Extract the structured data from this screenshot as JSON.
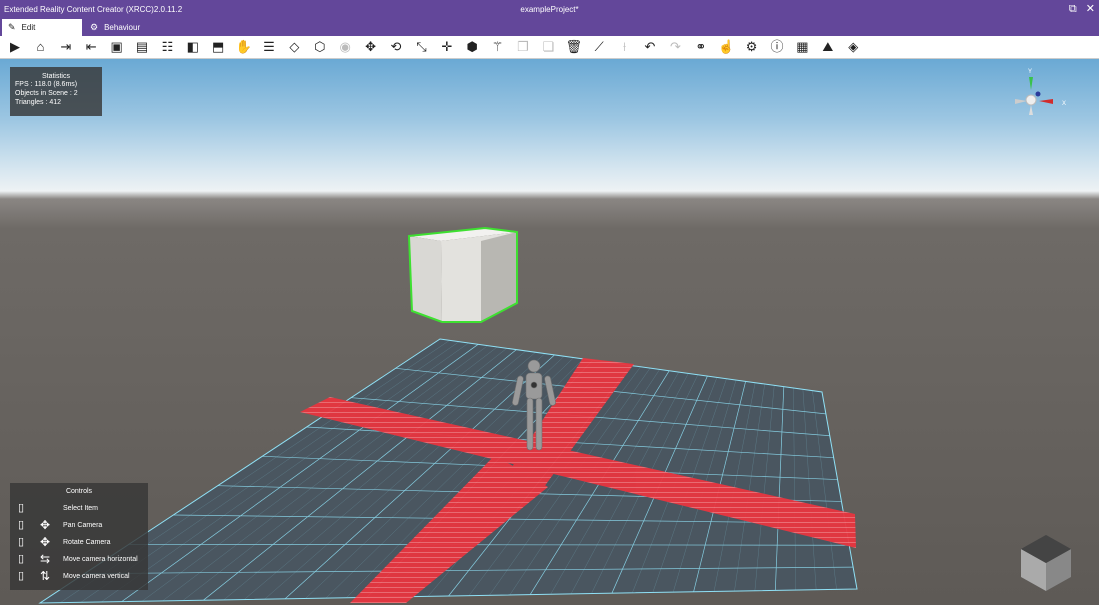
{
  "window": {
    "app_title": "Extended Reality Content Creator (XRCC)2.0.11.2",
    "document_title": "exampleProject*",
    "controls": [
      "restore-icon",
      "close-icon"
    ]
  },
  "tabs": [
    {
      "label": "Edit",
      "icon": "edit-icon",
      "active": true
    },
    {
      "label": "Behaviour",
      "icon": "gear-icon",
      "active": false
    }
  ],
  "toolbar": {
    "tools": [
      "play-icon",
      "home-icon",
      "import-icon",
      "export-icon",
      "save-icon",
      "save-as-icon",
      "hierarchy-icon",
      "box-icon",
      "package-icon",
      "hand-icon",
      "user-list-icon",
      "cube-outline-icon",
      "cube-add-icon",
      "eye-icon",
      "move-icon",
      "rotate-icon",
      "scale-icon",
      "transform-icon",
      "object-icon",
      "wand-icon",
      "copy-icon",
      "paste-icon",
      "delete-icon",
      "measure-icon",
      "snap-icon",
      "undo-icon",
      "redo-icon",
      "link-icon",
      "touch-icon",
      "settings-icon",
      "info-icon",
      "clipboard-icon",
      "terrain-icon",
      "unity-icon"
    ]
  },
  "statistics": {
    "title": "Statistics",
    "fps": "FPS : 118.0 (8.6ms)",
    "objects": "Objects in Scene : 2",
    "triangles": "Triangles : 412"
  },
  "controls_panel": {
    "title": "Controls",
    "items": [
      {
        "label": "Select Item",
        "icon": "left-mouse-icon"
      },
      {
        "label": "Pan Camera",
        "icon": "pan-icon"
      },
      {
        "label": "Rotate Camera",
        "icon": "rotate-camera-icon"
      },
      {
        "label": "Move camera horizontal",
        "icon": "horizontal-move-icon"
      },
      {
        "label": "Move camera vertical",
        "icon": "vertical-move-icon"
      }
    ]
  },
  "gizmo": {
    "x_label": "X",
    "y_label": "Y"
  },
  "colors": {
    "title_bar": "#63479a",
    "grid_line": "#8fe0f5",
    "path_red": "#e8353f",
    "selection_outline": "#3ee031",
    "sky": "#9cc6e2",
    "ground": "#6e6a66"
  }
}
